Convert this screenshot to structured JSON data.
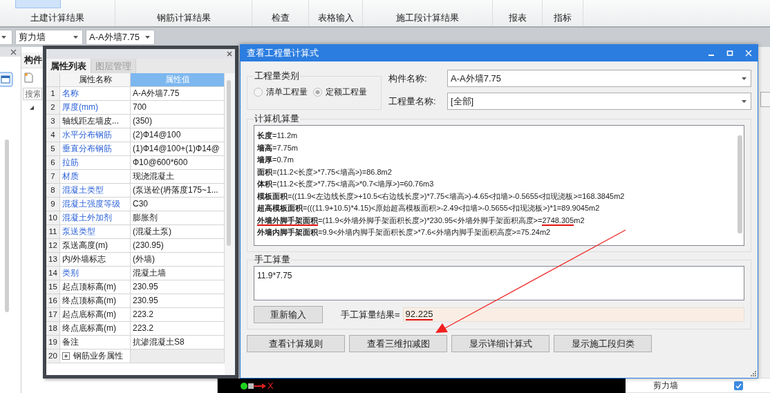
{
  "ribbon": {
    "groups": [
      {
        "label": "土建计算结果",
        "active": true
      },
      {
        "label": "钢筋计算结果",
        "active": false
      },
      {
        "label": "检查",
        "active": false
      },
      {
        "label": "表格输入",
        "active": false
      },
      {
        "label": "施工段计算结果",
        "active": false
      },
      {
        "label": "报表",
        "active": false
      },
      {
        "label": "指标",
        "active": false
      }
    ]
  },
  "toolbar": {
    "combos": [
      {
        "kind": "blank"
      },
      {
        "kind": "text",
        "value": "剪力墙"
      },
      {
        "kind": "text",
        "value": "A-A外墙7.75"
      }
    ]
  },
  "component_panel": {
    "tab": "构件",
    "search_placeholder": "搜索",
    "tree": [
      {
        "expanded": true
      }
    ]
  },
  "property_window": {
    "tabs": [
      {
        "label": "属性列表",
        "selected": true
      },
      {
        "label": "图层管理",
        "selected": false
      }
    ],
    "columns": [
      "属性名称",
      "属性值"
    ],
    "rows": [
      {
        "index": "1",
        "kind": "field",
        "name": "名称",
        "value": "A-A外墙7.75",
        "highlighted": true
      },
      {
        "index": "2",
        "kind": "field",
        "name": "厚度(mm)",
        "value": "700",
        "highlighted": true
      },
      {
        "index": "3",
        "kind": "field",
        "name": "轴线距左墙皮...",
        "value": "(350)",
        "highlighted": false
      },
      {
        "index": "4",
        "kind": "field",
        "name": "水平分布钢筋",
        "value": "(2)Ф14@100",
        "highlighted": true
      },
      {
        "index": "5",
        "kind": "field",
        "name": "垂直分布钢筋",
        "value": "(1)Ф14@100+(1)Ф14@",
        "highlighted": true
      },
      {
        "index": "6",
        "kind": "field",
        "name": "拉筋",
        "value": "Ф10@600*600",
        "highlighted": true
      },
      {
        "index": "7",
        "kind": "field",
        "name": "材质",
        "value": "现浇混凝土",
        "highlighted": true
      },
      {
        "index": "8",
        "kind": "field",
        "name": "混凝土类型",
        "value": "(泵送砼(坍落度175~1...",
        "highlighted": true
      },
      {
        "index": "9",
        "kind": "field",
        "name": "混凝土强度等级",
        "value": "C30",
        "highlighted": true
      },
      {
        "index": "10",
        "kind": "field",
        "name": "混凝土外加剂",
        "value": "膨胀剂",
        "highlighted": true
      },
      {
        "index": "11",
        "kind": "field",
        "name": "泵送类型",
        "value": "(混凝土泵)",
        "highlighted": true
      },
      {
        "index": "12",
        "kind": "field",
        "name": "泵送高度(m)",
        "value": "(230.95)",
        "highlighted": false
      },
      {
        "index": "13",
        "kind": "field",
        "name": "内/外墙标志",
        "value": "(外墙)",
        "highlighted": false
      },
      {
        "index": "14",
        "kind": "field",
        "name": "类别",
        "value": "混凝土墙",
        "highlighted": true
      },
      {
        "index": "15",
        "kind": "field",
        "name": "起点顶标高(m)",
        "value": "230.95",
        "highlighted": false
      },
      {
        "index": "16",
        "kind": "field",
        "name": "终点顶标高(m)",
        "value": "230.95",
        "highlighted": false
      },
      {
        "index": "17",
        "kind": "field",
        "name": "起点底标高(m)",
        "value": "223.2",
        "highlighted": false
      },
      {
        "index": "18",
        "kind": "field",
        "name": "终点底标高(m)",
        "value": "223.2",
        "highlighted": false
      },
      {
        "index": "19",
        "kind": "field",
        "name": "备注",
        "value": "抗渗混凝土S8",
        "highlighted": false
      },
      {
        "index": "20",
        "kind": "group",
        "name": "钢筋业务属性",
        "highlighted": false
      }
    ]
  },
  "calc_dialog": {
    "title": "查看工程量计算式",
    "category": {
      "legend": "工程量类别",
      "options": [
        {
          "label": "清单工程量",
          "selected": false
        },
        {
          "label": "定额工程量",
          "selected": true
        }
      ]
    },
    "fields": [
      {
        "label": "构件名称:",
        "value": "A-A外墙7.75"
      },
      {
        "label": "工程量名称:",
        "value": "[全部]"
      }
    ],
    "computed": {
      "legend": "计算机算量",
      "lines": [
        {
          "text": "**长度**=",
          "result": "11.2",
          "unit": "m",
          "marked": false
        },
        {
          "text": "**墙高**=",
          "result": "7.75",
          "unit": "m",
          "marked": false
        },
        {
          "text": "**墙厚**=",
          "result": "0.7",
          "unit": "m",
          "marked": false
        },
        {
          "text": "**面积**=(11.2<长度>*7.75<墙高>)=",
          "result": "86.8",
          "unit": "m2",
          "marked": false
        },
        {
          "text": "**体积**=(11.2<长度>*7.75<墙高>*0.7<墙厚>)=",
          "result": "60.76",
          "unit": "m3",
          "marked": false
        },
        {
          "text": "**模板面积**=((11.9<左边线长度>+10.5<右边线长度>)*7.75<墙高>)-4.65<扣墙>-0.5655<扣现浇板>=",
          "result": "168.3845",
          "unit": "m2",
          "marked": false
        },
        {
          "text": "**超高模板面积**=(((11.9+10.5)*4.15)<原始超高模板面积>-2.49<扣墙>-0.5655<扣现浇板>)*1=",
          "result": "89.9045",
          "unit": "m2",
          "marked": false
        },
        {
          "text": "**外墙外脚手架面积**=(11.9<外墙外脚手架面积长度>)*230.95<外墙外脚手架面积高度>=",
          "result": "2748.305",
          "unit": "m2",
          "marked": true
        },
        {
          "text": "**外墙内脚手架面积**=9.9<外墙内脚手架面积长度>*7.6<外墙内脚手架面积高度>=",
          "result": "75.24",
          "unit": "m2",
          "marked": false
        }
      ]
    },
    "manual": {
      "legend": "手工算量",
      "input": "11.9*7.75",
      "reset_button": "重新输入",
      "result_label": "手工算量结果=",
      "result": "92.225",
      "marked": true
    },
    "buttons": [
      "查看计算规则",
      "查看三维扣减图",
      "显示详细计算式",
      "显示施工段归类"
    ]
  },
  "canvas": {
    "axis_label": "X"
  },
  "right_panel": {
    "rows": [
      {
        "label": "剪力墙",
        "checked": true
      }
    ]
  }
}
